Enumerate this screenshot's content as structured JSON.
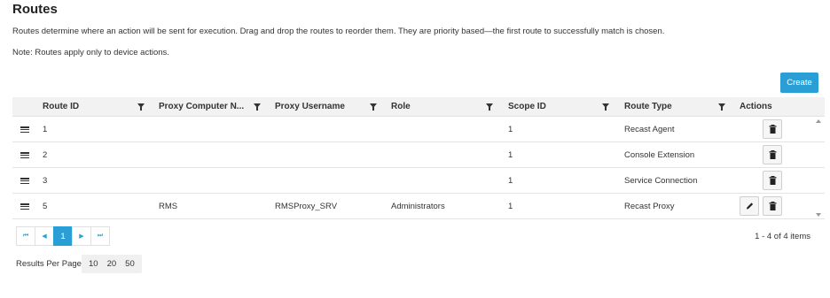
{
  "page": {
    "title": "Routes",
    "description": "Routes determine where an action will be sent for execution. Drag and drop the routes to reorder them. They are priority based—the first route to successfully match is chosen.",
    "note": "Note: Routes apply only to device actions."
  },
  "toolbar": {
    "create_label": "Create"
  },
  "grid": {
    "columns": [
      "Route ID",
      "Proxy Computer N...",
      "Proxy Username",
      "Role",
      "Scope ID",
      "Route Type",
      "Actions"
    ],
    "rows": [
      {
        "route_id": "1",
        "proxy_computer": "",
        "proxy_username": "",
        "role": "",
        "scope_id": "1",
        "route_type": "Recast Agent",
        "editable": false
      },
      {
        "route_id": "2",
        "proxy_computer": "",
        "proxy_username": "",
        "role": "",
        "scope_id": "1",
        "route_type": "Console Extension",
        "editable": false
      },
      {
        "route_id": "3",
        "proxy_computer": "",
        "proxy_username": "",
        "role": "",
        "scope_id": "1",
        "route_type": "Service Connection",
        "editable": false
      },
      {
        "route_id": "5",
        "proxy_computer": "RMS",
        "proxy_username": "RMSProxy_SRV",
        "role": "Administrators",
        "scope_id": "1",
        "route_type": "Recast Proxy",
        "editable": true
      }
    ]
  },
  "pager": {
    "first": "⏮",
    "prev": "◀",
    "current_page": "1",
    "next": "▶",
    "last": "⏭",
    "summary": "1 - 4 of 4 items",
    "results_per_page_label": "Results Per Page:",
    "page_size_options": [
      "10",
      "20",
      "50"
    ]
  },
  "colors": {
    "accent": "#2a9fd6",
    "header_bg": "#f2f2f2"
  }
}
